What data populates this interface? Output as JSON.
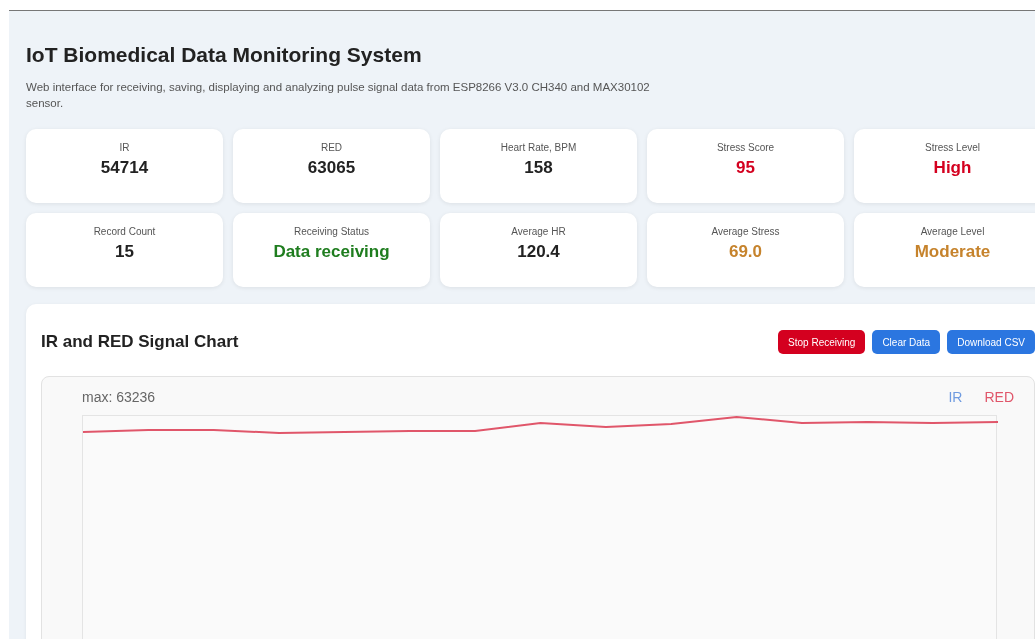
{
  "header": {
    "title": "IoT Biomedical Data Monitoring System",
    "subtitle": "Web interface for receiving, saving, displaying and analyzing pulse signal data from ESP8266 V3.0 CH340 and MAX30102 sensor."
  },
  "stats": [
    {
      "label": "IR",
      "value": "54714",
      "color": "#222222"
    },
    {
      "label": "RED",
      "value": "63065",
      "color": "#222222"
    },
    {
      "label": "Heart Rate, BPM",
      "value": "158",
      "color": "#222222"
    },
    {
      "label": "Stress Score",
      "value": "95",
      "color": "#d4001f"
    },
    {
      "label": "Stress Level",
      "value": "High",
      "color": "#d4001f"
    },
    {
      "label": "Record Count",
      "value": "15",
      "color": "#222222"
    },
    {
      "label": "Receiving Status",
      "value": "Data receiving",
      "color": "#1f7d1f"
    },
    {
      "label": "Average HR",
      "value": "120.4",
      "color": "#222222"
    },
    {
      "label": "Average Stress",
      "value": "69.0",
      "color": "#c6832c"
    },
    {
      "label": "Average Level",
      "value": "Moderate",
      "color": "#c6832c"
    }
  ],
  "chart_panel": {
    "title": "IR and RED Signal Chart",
    "buttons": [
      {
        "label": "Stop Receiving",
        "kind": "danger"
      },
      {
        "label": "Clear Data",
        "kind": "primary"
      },
      {
        "label": "Download CSV",
        "kind": "primary"
      }
    ],
    "chart": {
      "max_label": "max: 63236",
      "legend": [
        {
          "label": "IR",
          "color": "#6f9be0"
        },
        {
          "label": "RED",
          "color": "#e0566a"
        }
      ]
    }
  }
}
